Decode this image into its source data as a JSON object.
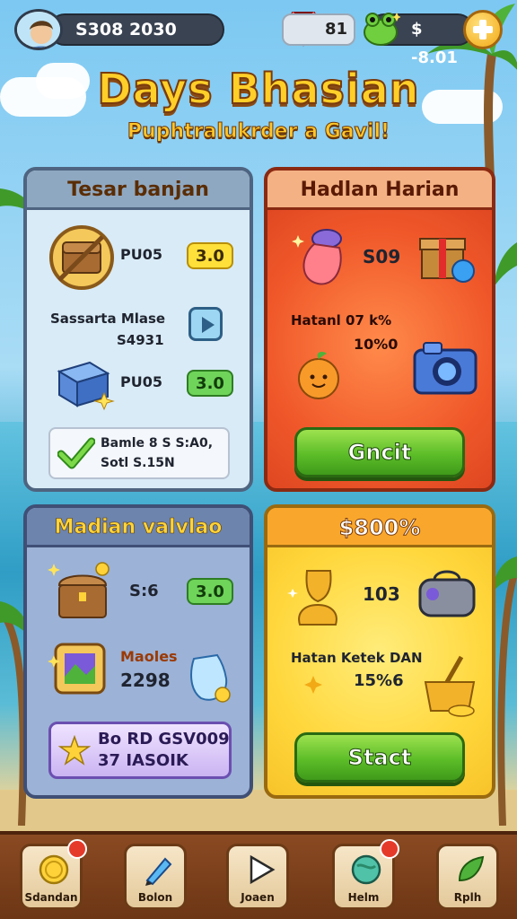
{
  "header": {
    "score": "S308 2030",
    "gems": "81",
    "coins": "$ -8.01"
  },
  "title": {
    "main": "Days Bhasian",
    "sub": "Puphtralukrder a Gavil!"
  },
  "panel_top_left": {
    "title": "Tesar banjan",
    "row1": {
      "label": "PU05",
      "value": "3.0"
    },
    "row2": {
      "label_line1": "Sassarta Mlase",
      "label_line2": "S4931"
    },
    "row3": {
      "label": "PU05",
      "value": "3.0"
    },
    "notice": {
      "line1": "Bamle 8 S S:A0,",
      "line2": "Sotl S.15N"
    }
  },
  "panel_top_right": {
    "title": "Hadlan Harian",
    "reward1": "S09",
    "reward2_line1": "Hatanl 07 k%",
    "reward2_line2": "10%0",
    "button": "Gncit"
  },
  "panel_bottom_left": {
    "title": "Madian valvlao",
    "row1": {
      "label": "S:6",
      "value": "3.0"
    },
    "row2": {
      "label_line1": "Maoles",
      "label_line2": "2298"
    },
    "promo": {
      "line1": "Bo RD GSV009",
      "line2": "37 IASOIK"
    }
  },
  "panel_bottom_right": {
    "title": "$800%",
    "reward1": "103",
    "reward2_line1": "Hatan Ketek DAN",
    "reward2_line2": "15%6",
    "button": "Stact"
  },
  "bottom_nav": [
    {
      "label": "Sdandan",
      "icon": "gold-coin-icon",
      "badge": true
    },
    {
      "label": "Bolon",
      "icon": "pencil-icon",
      "badge": false
    },
    {
      "label": "Joaen",
      "icon": "play-icon",
      "badge": false
    },
    {
      "label": "Helm",
      "icon": "globe-icon",
      "badge": true
    },
    {
      "label": "Rplh",
      "icon": "leaf-icon",
      "badge": false
    }
  ],
  "colors": {
    "title": "#ffcf29",
    "green_button": "#5cbd28",
    "panel_red": "#f0582a",
    "panel_yellow": "#ffd73c"
  }
}
